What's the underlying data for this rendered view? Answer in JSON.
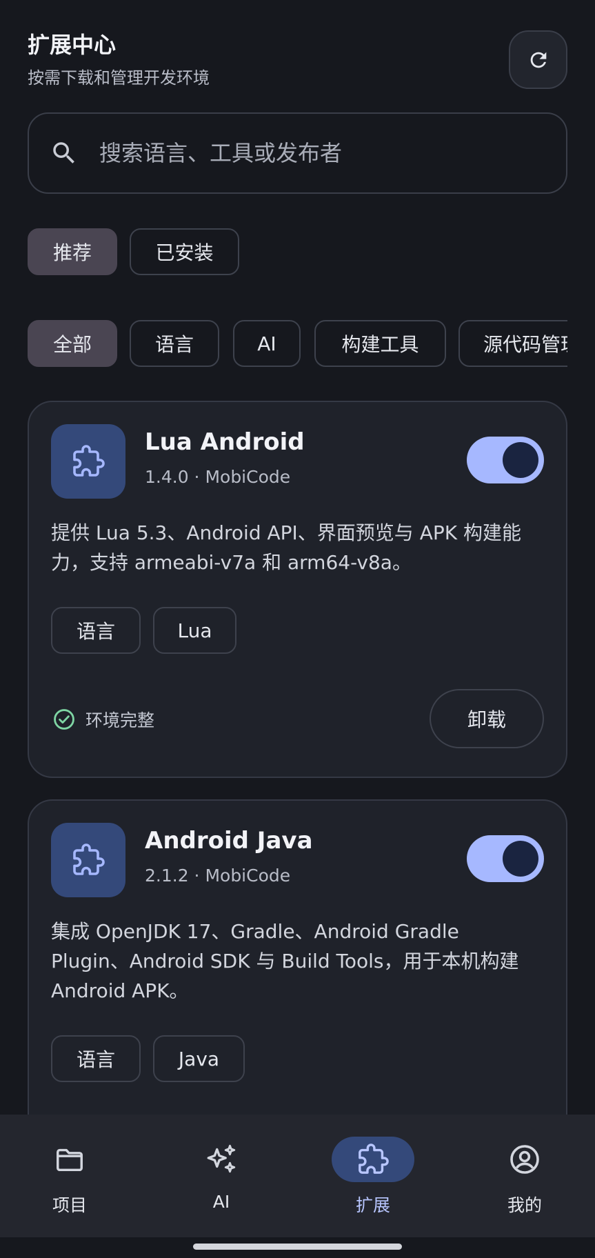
{
  "header": {
    "title": "扩展中心",
    "subtitle": "按需下载和管理开发环境",
    "refresh_icon": "refresh-icon"
  },
  "search": {
    "placeholder": "搜索语言、工具或发布者",
    "value": ""
  },
  "view_tabs": [
    {
      "label": "推荐",
      "selected": true
    },
    {
      "label": "已安装",
      "selected": false
    }
  ],
  "categories": [
    {
      "label": "全部",
      "selected": true
    },
    {
      "label": "语言",
      "selected": false
    },
    {
      "label": "AI",
      "selected": false
    },
    {
      "label": "构建工具",
      "selected": false
    },
    {
      "label": "源代码管理",
      "selected": false
    }
  ],
  "extensions": [
    {
      "name": "Lua Android",
      "meta": "1.4.0 · MobiCode",
      "enabled": true,
      "description": "提供 Lua 5.3、Android API、界面预览与 APK 构建能力，支持 armeabi-v7a 和 arm64-v8a。",
      "tags": [
        "语言",
        "Lua"
      ],
      "status": "环境完整",
      "action": "卸载"
    },
    {
      "name": "Android Java",
      "meta": "2.1.2 · MobiCode",
      "enabled": true,
      "description": "集成 OpenJDK 17、Gradle、Android Gradle Plugin、Android SDK 与 Build Tools，用于本机构建 Android APK。",
      "tags": [
        "语言",
        "Java"
      ]
    }
  ],
  "bottom_nav": [
    {
      "label": "项目",
      "icon": "folder-icon",
      "active": false
    },
    {
      "label": "AI",
      "icon": "sparkle-icon",
      "active": false
    },
    {
      "label": "扩展",
      "icon": "puzzle-icon",
      "active": true
    },
    {
      "label": "我的",
      "icon": "account-icon",
      "active": false
    }
  ],
  "colors": {
    "background": "#16181e",
    "card": "#1f222a",
    "accent": "#a6b8ff",
    "accent_container": "#34497a",
    "status_ok": "#7fd6a4"
  }
}
